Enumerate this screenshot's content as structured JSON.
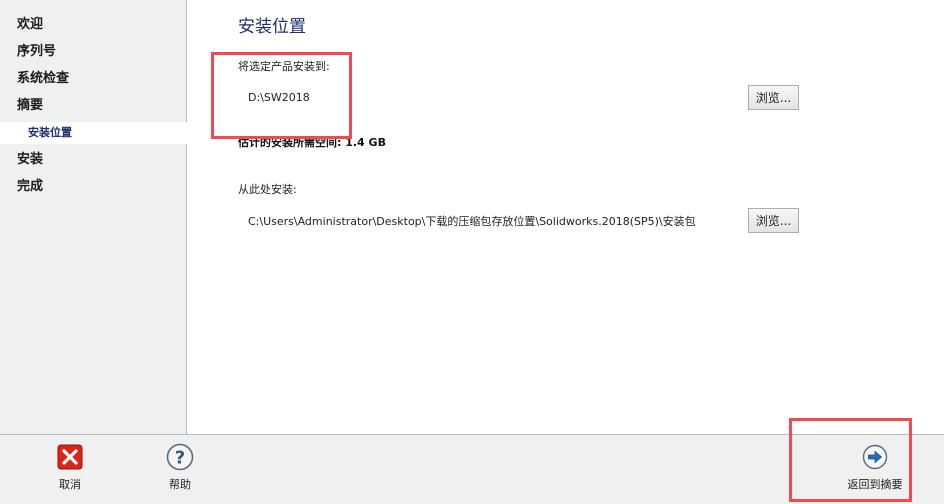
{
  "sidebar": {
    "items": [
      {
        "label": "欢迎"
      },
      {
        "label": "序列号"
      },
      {
        "label": "系统检查"
      },
      {
        "label": "摘要"
      },
      {
        "label": "安装位置"
      },
      {
        "label": "安装"
      },
      {
        "label": "完成"
      }
    ]
  },
  "main": {
    "title": "安装位置",
    "install_to": {
      "label": "将选定产品安装到:",
      "value": "D:\\SW2018",
      "browse_label": "浏览..."
    },
    "estimated_space": "估计的安装所需空间: 1.4 GB",
    "install_from": {
      "label": "从此处安装:",
      "value": "C:\\Users\\Administrator\\Desktop\\下载的压缩包存放位置\\Solidworks.2018(SP5)\\安装包",
      "browse_label": "浏览..."
    }
  },
  "footer": {
    "cancel_label": "取消",
    "help_label": "帮助",
    "back_label": "返回到摘要"
  },
  "colors": {
    "accent": "#1f2f6e",
    "highlight": "#ef4b55",
    "cancel_icon": "#d9261c",
    "back_icon": "#2a6bb0"
  }
}
